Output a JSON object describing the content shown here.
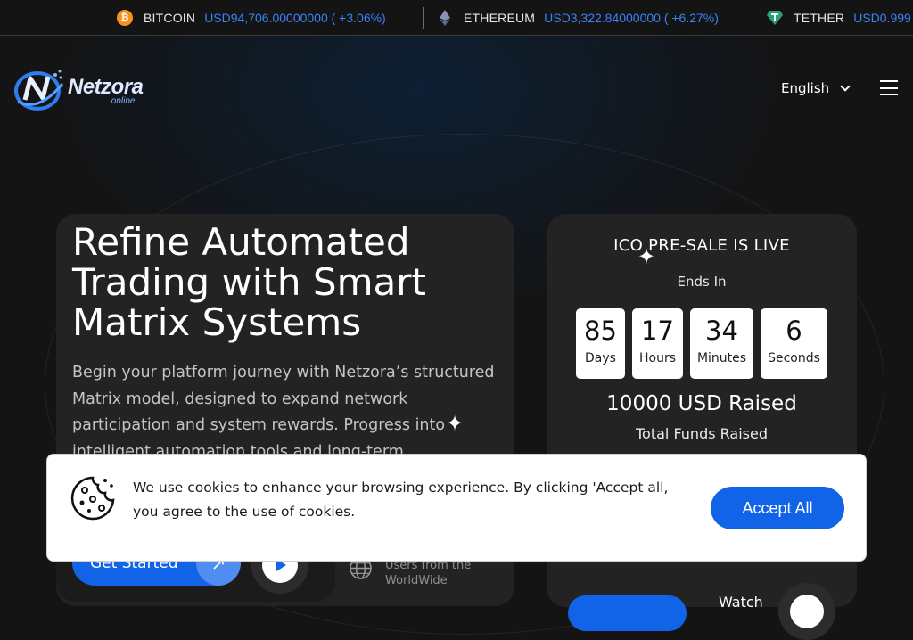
{
  "ticker": [
    {
      "name": "BITCOIN",
      "value": "USD94,706.00000000 ( +3.06%)",
      "icon": "bitcoin-icon",
      "color": "#f7931a"
    },
    {
      "name": "ETHEREUM",
      "value": "USD3,322.84000000 ( +6.27%)",
      "icon": "ethereum-icon",
      "color": "#8a92b2"
    },
    {
      "name": "TETHER",
      "value": "USD0.999",
      "icon": "tether-icon",
      "color": "#26a17b"
    }
  ],
  "brand": {
    "name": "Netzora",
    "sub": ".online"
  },
  "header": {
    "language": "English"
  },
  "hero": {
    "title": "Refine Automated Trading with Smart Matrix Systems",
    "description": "Begin your platform journey with Netzora’s structured Matrix model, designed to expand network participation and system rewards. Progress into intelligent automation tools and long-term",
    "cta_label": "Get Started",
    "world_text": "Users from the WorldWide"
  },
  "ico": {
    "title": "ICO PRE-SALE IS LIVE",
    "ends_in": "Ends In",
    "countdown": [
      {
        "value": "85",
        "label": "Days"
      },
      {
        "value": "17",
        "label": "Hours"
      },
      {
        "value": "34",
        "label": "Minutes"
      },
      {
        "value": "6",
        "label": "Seconds"
      }
    ],
    "raised": "10000 USD Raised",
    "raised_label": "Total Funds Raised",
    "watch_label": "Watch"
  },
  "cookie": {
    "text": "We use cookies to enhance your browsing experience. By clicking 'Accept all, you agree to the use of cookies.",
    "accept_label": "Accept All"
  },
  "colors": {
    "accent": "#1163e8",
    "background": "#141414",
    "card": "#232323",
    "ticker_value": "#3b82f6"
  }
}
